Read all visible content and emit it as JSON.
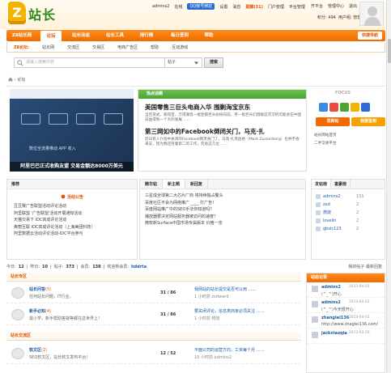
{
  "logo": {
    "letter": "Z",
    "text": "站长"
  },
  "userbar": {
    "username": "admins2",
    "status": "在线",
    "qq": "QQ帐号绑定",
    "links": [
      "设置",
      "消息",
      "提醒(31)",
      "门户管理",
      "平台管理"
    ],
    "row2": [
      "积分: 494",
      "用户组: 管理员"
    ],
    "right_links": [
      "开平台",
      "管理中心",
      "退出"
    ]
  },
  "nav": {
    "items": [
      "Z8站长网",
      "论坛",
      "站长动态",
      "站长工具",
      "排行榜",
      "每日签到",
      "帮助"
    ],
    "active_index": 1,
    "quick": "快捷导航"
  },
  "subnav": {
    "first": "Z8论坛:",
    "items": [
      "站长网",
      "交流区",
      "交易区",
      "电商广告区",
      "帮助",
      "互动游戏"
    ]
  },
  "search": {
    "placeholder": "请输入搜索内容",
    "scope": "帖子",
    "button": "搜索"
  },
  "breadcrumb": "论坛",
  "slide": {
    "caption": "阿里巴巴正式收购友盟 交易金额达8000万美元",
    "subtitle": "数位全流量推动 APP 收入"
  },
  "hot": {
    "header": "热点话题",
    "items": [
      {
        "title": "美国零售三巨头电商入华 围剿海宝京东",
        "text": "当百货式、家得宝、万得潮等一批连锁巨头纷纷向前，另一批巨头们借助这次交机可能会在中国日益得到一个大的发展 ……"
      },
      {
        "title": "第三网如中的Facebook倒闭关门，马克·扎",
        "text": "近日有人介绍中关闭的Facebook网页关门了，马克·扎克伯格（Mark Zuckerberg）也并不会来支，因为我还有着第二的工作，究竟这几位 ……"
      }
    ]
  },
  "focus": {
    "label": "FOCUS",
    "buttons": [
      "发新帖",
      "我要签到"
    ],
    "lines": [
      "站长网站首页",
      "二手交易平台"
    ]
  },
  "recommend": {
    "header": "推荐",
    "notice": "活动公告",
    "items": [
      "豆豆赛广告联盟活动评论活动",
      "阿里联盟 '广告联盟'活动开展通知活动",
      "天猫交易下 IDC高成评论活动",
      "奥丽互联 IDC高成评论活动（上海美团科技）",
      "阿里数据云活动评论活动-IDC平台参与"
    ]
  },
  "latest": {
    "tabs": [
      "精华帖",
      "新主题",
      "新回复"
    ],
    "active_tab": 1,
    "items": [
      "三星成全球第二大芯片厂商 将持续独占鳌头",
      "百度社区不会为网络推广 ____ 打广告！",
      "百度网站推广中的SEO手法你知道吗？",
      "播放器要决定网站服务器被访问的速度？",
      "微软新Surface中国市场专属版本 价格一览"
    ]
  },
  "rank": {
    "tabs": [
      "发帖榜",
      "富豪榜"
    ],
    "active_tab": 0,
    "users": [
      {
        "name": "admins2",
        "count": "151"
      },
      {
        "name": "zxd",
        "count": "2"
      },
      {
        "name": "燃烧",
        "count": "2"
      },
      {
        "name": "lovelin",
        "count": "2"
      },
      {
        "name": "gbslc123",
        "count": "2"
      }
    ]
  },
  "stats": {
    "today_label": "今日:",
    "today": "12",
    "yesterday_label": "昨日:",
    "yesterday": "10",
    "posts_label": "帖子:",
    "posts": "373",
    "members_label": "会员:",
    "members": "138",
    "newest_label": "欢迎新会员:",
    "newest": "hddrta",
    "right": "我的帖子 最新回复"
  },
  "forums": [
    {
      "section": "站长专区",
      "items": [
        {
          "name": "站长问答",
          "new": "(5)",
          "desc": "任何站长问题，IT行业。",
          "count": "31 / 86",
          "last_title": "我网站的站长提交是否可以用 ……",
          "last_by": "1 小时前 zxdward"
        },
        {
          "name": "新手必知",
          "new": "(4)",
          "desc": "需小学，新手帮助答疑等都在这世界上！",
          "count": "31 / 86",
          "last_title": "要关闭评论，信息类商家必须关注 ……",
          "last_by": "1 小时前 燃烧"
        }
      ]
    },
    {
      "section": "站长交流区",
      "items": [
        {
          "name": "软文区",
          "new": "(2)",
          "desc": "SEO软文区，站长软文发布平台！",
          "count": "12 / 52",
          "last_title": "平面公司的运营方向，工资每个月 ……",
          "last_by": "10 小时前 admins2"
        }
      ]
    }
  ],
  "dynamic": {
    "header": "动态记录",
    "records": [
      {
        "name": "admins2",
        "date": "2013-04-02",
        "msg": "(^_^)开心"
      },
      {
        "name": "admins2",
        "date": "2013-04-02",
        "msg": "(^_^)今天很开心"
      },
      {
        "name": "zhanglei136",
        "date": "2013-04-02",
        "msg": "http://www.zhaglei136.com/"
      },
      {
        "name": "jackxiaoqia",
        "date": "2013-03-26",
        "msg": ""
      }
    ]
  },
  "colors": {
    "accent": "#f06a00",
    "link": "#1a5aa8",
    "hot": "#4aa532"
  }
}
